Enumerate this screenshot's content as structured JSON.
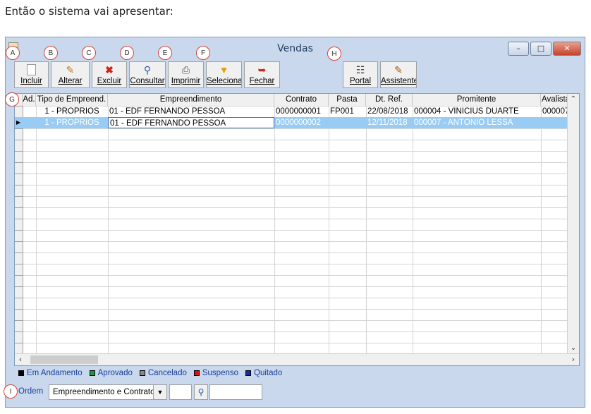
{
  "caption": "Então o sistema vai apresentar:",
  "window": {
    "title": "Vendas"
  },
  "toolbar": [
    {
      "label": "Incluir",
      "icon": "new-document-icon",
      "marker": "A"
    },
    {
      "label": "Alterar",
      "icon": "edit-icon",
      "marker": "B"
    },
    {
      "label": "Excluir",
      "icon": "delete-x-icon",
      "marker": "C"
    },
    {
      "label": "Consultar",
      "icon": "magnifier-icon",
      "marker": "D"
    },
    {
      "label": "Imprimir",
      "icon": "printer-icon",
      "marker": "E"
    },
    {
      "label": "Seleciona",
      "icon": "funnel-icon",
      "marker": "F"
    },
    {
      "label": "Fechar",
      "icon": "exit-door-icon",
      "marker": ""
    },
    {
      "label": "Portal",
      "icon": "portal-icon",
      "marker": "H"
    },
    {
      "label": "Assistente",
      "icon": "assistant-icon",
      "marker": ""
    }
  ],
  "grid": {
    "marker": "G",
    "columns": [
      "Ad.",
      "Tipo de Empreend.",
      "Empreendimento",
      "Contrato",
      "Pasta",
      "Dt. Ref.",
      "Promitente",
      "Avalista"
    ],
    "rows": [
      {
        "ad": "",
        "tipo": "1 - PROPRIOS",
        "empreendimento": "01 - EDF FERNANDO PESSOA",
        "contrato": "0000000001",
        "pasta": "FP001",
        "dt_ref": "22/08/2018",
        "promitente": "000004 - VINICIUS DUARTE",
        "avalista": "000007"
      },
      {
        "ad": "",
        "tipo": "1 - PROPRIOS",
        "empreendimento": "01 - EDF FERNANDO PESSOA",
        "contrato": "0000000002",
        "pasta": "",
        "dt_ref": "12/11/2018",
        "promitente": "000007 - ANTONIO LESSA",
        "avalista": ""
      }
    ],
    "selected_row": 1
  },
  "legend": [
    {
      "label": "Em Andamento",
      "color": "#000000"
    },
    {
      "label": "Aprovado",
      "color": "#1a9a3a"
    },
    {
      "label": "Cancelado",
      "color": "#8a8a8a"
    },
    {
      "label": "Suspenso",
      "color": "#e01010"
    },
    {
      "label": "Quitado",
      "color": "#1a2a9a"
    }
  ],
  "order": {
    "marker": "I",
    "label": "Ordem",
    "selected": "Empreendimento e Contrato"
  },
  "colors": {
    "window_bg": "#c9d8ec",
    "selection": "#99ccf5",
    "marker_ring": "#d9413a"
  }
}
